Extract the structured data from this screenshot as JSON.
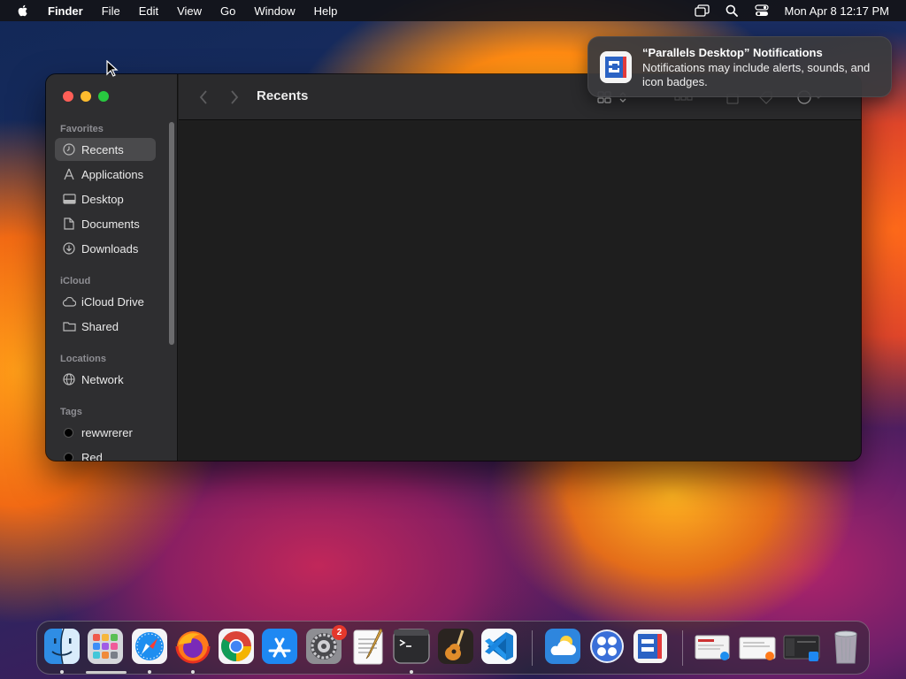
{
  "menubar": {
    "app_name": "Finder",
    "menus": [
      "File",
      "Edit",
      "View",
      "Go",
      "Window",
      "Help"
    ],
    "clock": "Mon Apr 8  12:17 PM",
    "status_icons": [
      "screen-mirroring-icon",
      "spotlight-search-icon",
      "control-center-icon"
    ]
  },
  "finder": {
    "title": "Recents",
    "sidebar": {
      "sections": {
        "favorites": "Favorites",
        "icloud": "iCloud",
        "locations": "Locations",
        "tags": "Tags"
      },
      "favorites": [
        {
          "label": "Recents",
          "icon": "clock-icon",
          "selected": true
        },
        {
          "label": "Applications",
          "icon": "applications-icon"
        },
        {
          "label": "Desktop",
          "icon": "desktop-icon"
        },
        {
          "label": "Documents",
          "icon": "document-icon"
        },
        {
          "label": "Downloads",
          "icon": "download-icon"
        }
      ],
      "icloud": [
        {
          "label": "iCloud Drive",
          "icon": "cloud-icon"
        },
        {
          "label": "Shared",
          "icon": "shared-folder-icon"
        }
      ],
      "locations": [
        {
          "label": "Network",
          "icon": "globe-icon"
        }
      ],
      "tags": [
        {
          "label": "rewwrerer",
          "color": "#000000"
        },
        {
          "label": "Red",
          "color": "#000000"
        }
      ]
    },
    "toolbar_icons": [
      "back-icon",
      "forward-icon",
      "icon-view-icon",
      "group-icon",
      "share-icon",
      "tag-icon",
      "action-icon",
      "search-icon"
    ]
  },
  "notification": {
    "title": "“Parallels Desktop” Notifications",
    "body": "Notifications may include alerts, sounds, and icon badges.",
    "app_icon": "parallels-desktop-icon"
  },
  "dock": {
    "apps": [
      {
        "name": "Finder",
        "icon": "finder-icon",
        "running": true
      },
      {
        "name": "Launchpad",
        "icon": "launchpad-icon",
        "running": false
      },
      {
        "name": "Safari",
        "icon": "safari-icon",
        "running": true
      },
      {
        "name": "Firefox",
        "icon": "firefox-icon",
        "running": true
      },
      {
        "name": "Google Chrome",
        "icon": "chrome-icon",
        "running": false
      },
      {
        "name": "App Store",
        "icon": "app-store-icon",
        "running": false
      },
      {
        "name": "System Settings",
        "icon": "system-settings-icon",
        "running": false,
        "badge": "2"
      },
      {
        "name": "TextEdit",
        "icon": "textedit-icon",
        "running": false
      },
      {
        "name": "Terminal",
        "icon": "terminal-icon",
        "running": true
      },
      {
        "name": "GarageBand",
        "icon": "garageband-icon",
        "running": false
      },
      {
        "name": "Visual Studio Code",
        "icon": "vscode-icon",
        "running": false
      },
      {
        "name": "Weather",
        "icon": "weather-icon",
        "running": false
      },
      {
        "name": "Parallels Toolbox",
        "icon": "parallels-toolbox-icon",
        "running": false
      },
      {
        "name": "Parallels Desktop",
        "icon": "parallels-desktop-icon",
        "running": false
      }
    ],
    "recents": [
      "recent-document-1-icon",
      "recent-document-2-icon",
      "recent-window-icon"
    ],
    "trash": "trash-icon",
    "colors": {
      "badge": "#e5382c"
    }
  }
}
